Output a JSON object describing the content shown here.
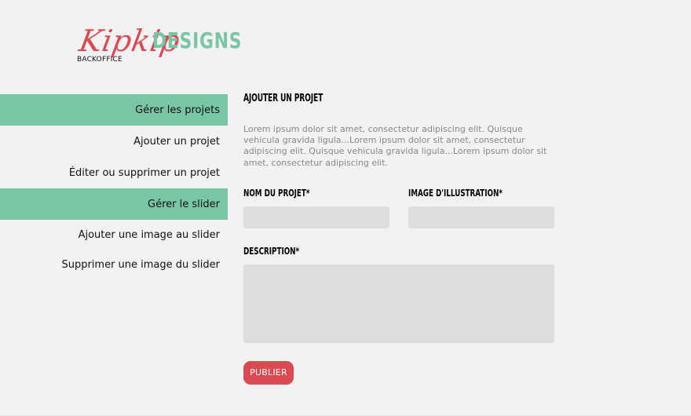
{
  "brand": {
    "script": "Kipkip",
    "word": "DESIGNS",
    "sub": "BACKOFFICE",
    "colors": {
      "script": "#db4a53",
      "word": "#78c6a3",
      "accent": "#78c6a3",
      "danger": "#db4a53",
      "background": "#f2f2f2",
      "inputBg": "#dddddd"
    }
  },
  "sidebar": {
    "items": [
      {
        "label": "Gérer les projets",
        "type": "section"
      },
      {
        "label": "Ajouter un projet",
        "type": "item"
      },
      {
        "label": "Éditer ou supprimer un projet",
        "type": "item"
      },
      {
        "label": "Gérer le slider",
        "type": "section"
      },
      {
        "label": "Ajouter une image au slider",
        "type": "item"
      },
      {
        "label": "Supprimer une image du slider",
        "type": "item"
      }
    ]
  },
  "main": {
    "title": "AJOUTER UN PROJET",
    "intro": "Lorem ipsum dolor sit amet, consectetur adipiscing elit. Quisque vehicula gravida ligula...Lorem ipsum dolor sit amet, consectetur adipiscing elit. Quisque vehicula gravida ligula...Lorem ipsum dolor sit amet, consectetur adipiscing elit.",
    "form": {
      "name_label": "NOM DU PROJET*",
      "name_value": "",
      "image_label": "IMAGE D'ILLUSTRATION*",
      "image_value": "",
      "description_label": "DESCRIPTION*",
      "description_value": "",
      "submit_label": "PUBLIER"
    }
  }
}
